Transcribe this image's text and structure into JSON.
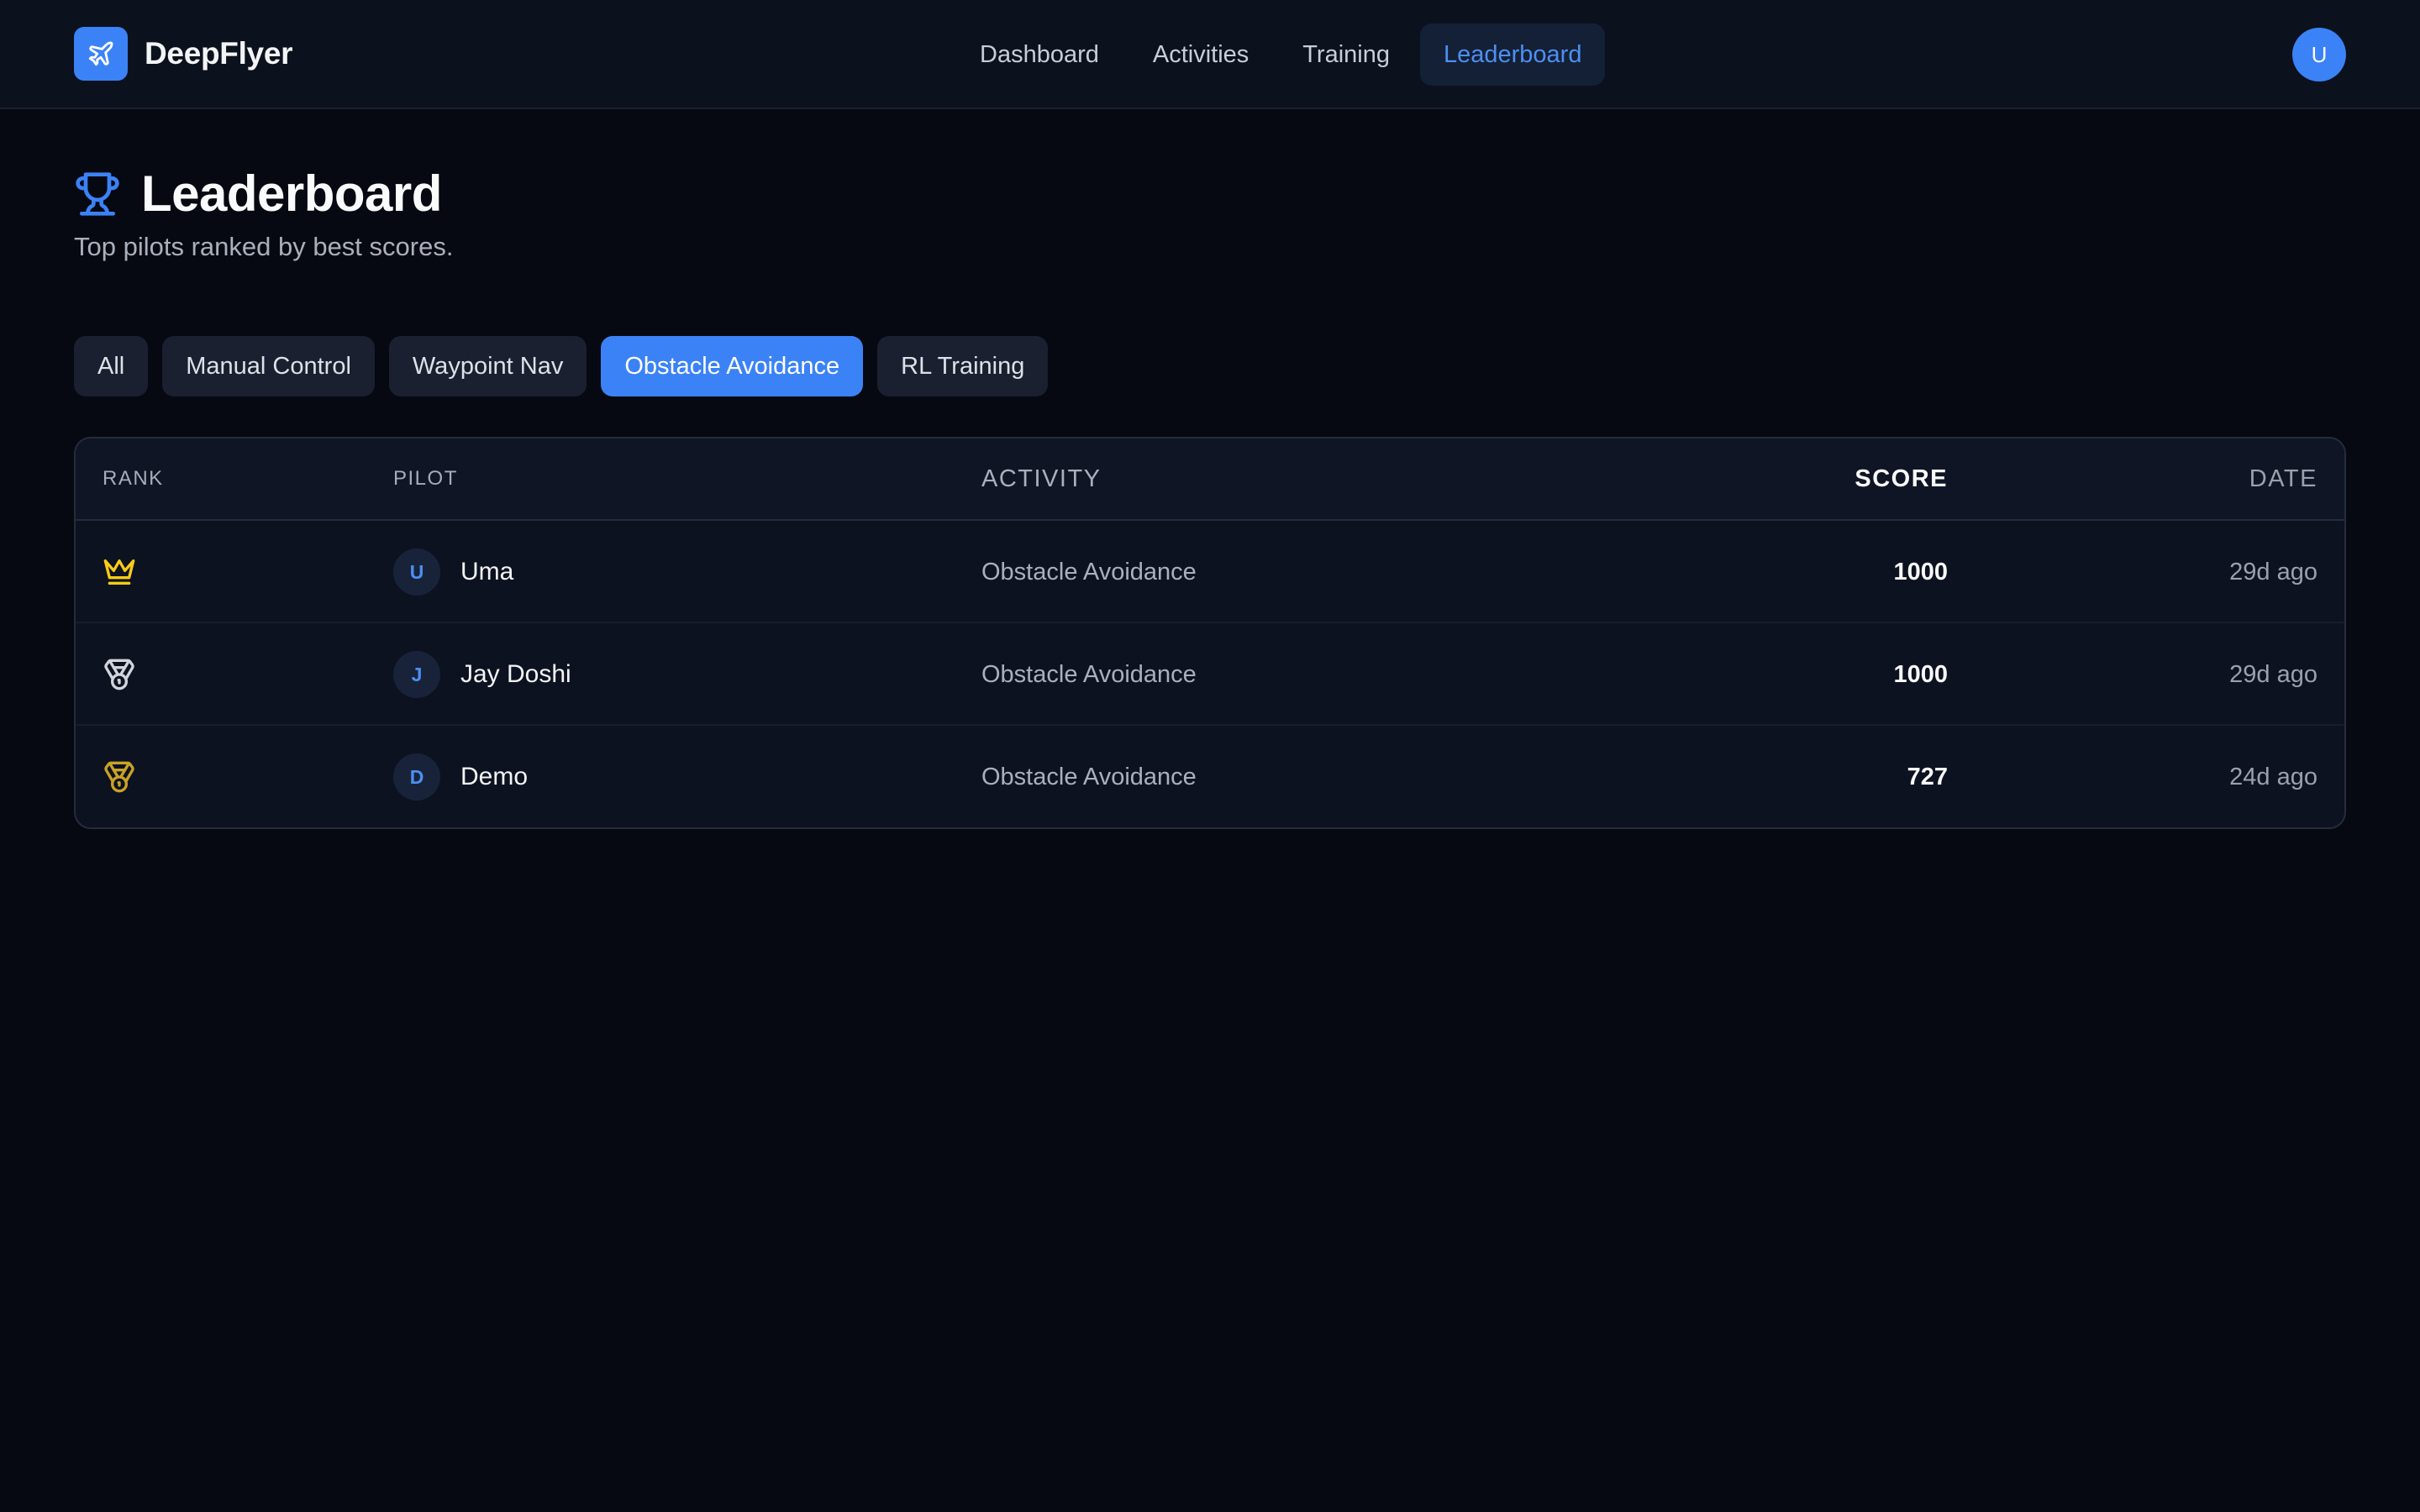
{
  "app": {
    "name": "DeepFlyer",
    "logo_icon": "plane-icon",
    "accent_color": "#3b82f6"
  },
  "nav": {
    "items": [
      {
        "label": "Dashboard",
        "active": false
      },
      {
        "label": "Activities",
        "active": false
      },
      {
        "label": "Training",
        "active": false
      },
      {
        "label": "Leaderboard",
        "active": true
      }
    ]
  },
  "user": {
    "initial": "U"
  },
  "page": {
    "title": "Leaderboard",
    "title_icon": "trophy-icon",
    "subtitle": "Top pilots ranked by best scores."
  },
  "filters": {
    "items": [
      {
        "label": "All",
        "active": false
      },
      {
        "label": "Manual Control",
        "active": false
      },
      {
        "label": "Waypoint Nav",
        "active": false
      },
      {
        "label": "Obstacle Avoidance",
        "active": true
      },
      {
        "label": "RL Training",
        "active": false
      }
    ]
  },
  "table": {
    "columns": {
      "rank": "RANK",
      "pilot": "PILOT",
      "activity": "ACTIVITY",
      "score": "SCORE",
      "date": "DATE"
    },
    "rows": [
      {
        "rank_icon": "crown-icon",
        "rank_color": "#facc15",
        "initial": "U",
        "pilot": "Uma",
        "activity": "Obstacle Avoidance",
        "score": "1000",
        "date": "29d ago"
      },
      {
        "rank_icon": "medal-icon",
        "rank_color": "#d1d5db",
        "initial": "J",
        "pilot": "Jay Doshi",
        "activity": "Obstacle Avoidance",
        "score": "1000",
        "date": "29d ago"
      },
      {
        "rank_icon": "medal-icon",
        "rank_color": "#c9a227",
        "initial": "D",
        "pilot": "Demo",
        "activity": "Obstacle Avoidance",
        "score": "727",
        "date": "24d ago"
      }
    ]
  }
}
